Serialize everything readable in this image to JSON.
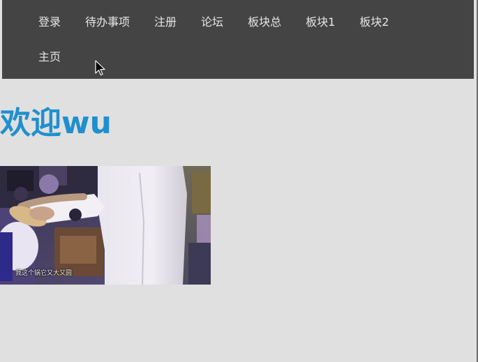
{
  "nav": {
    "row1": [
      "登录",
      "待办事项",
      "注册",
      "论坛",
      "板块总",
      "板块1",
      "板块2"
    ],
    "row2": [
      "主页"
    ]
  },
  "welcome": {
    "title": "欢迎wu"
  },
  "image": {
    "subtitle": "我这个锅它又大又圆"
  }
}
